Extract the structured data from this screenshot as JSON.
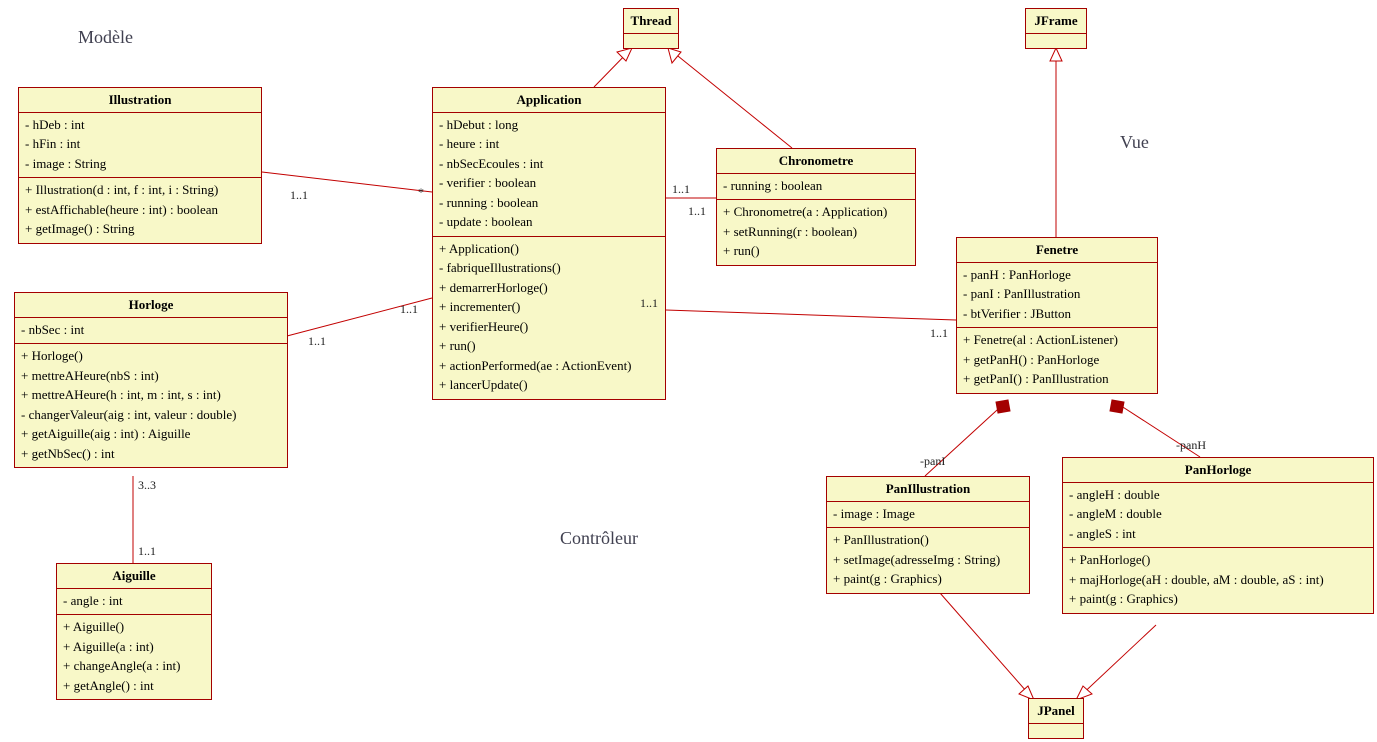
{
  "sections": {
    "modele": "Modèle",
    "vue": "Vue",
    "controleur": "Contrôleur"
  },
  "classes": {
    "thread": {
      "name": "Thread",
      "attrs": [],
      "ops": []
    },
    "jframe": {
      "name": "JFrame",
      "attrs": [],
      "ops": []
    },
    "jpanel": {
      "name": "JPanel",
      "attrs": [],
      "ops": []
    },
    "illustration": {
      "name": "Illustration",
      "attrs": [
        "- hDeb : int",
        "- hFin : int",
        "- image : String"
      ],
      "ops": [
        "+ Illustration(d : int, f : int, i : String)",
        "+ estAffichable(heure : int) : boolean",
        "+ getImage() : String"
      ]
    },
    "horloge": {
      "name": "Horloge",
      "attrs": [
        "- nbSec : int"
      ],
      "ops": [
        "+ Horloge()",
        "+ mettreAHeure(nbS : int)",
        "+ mettreAHeure(h : int, m : int, s : int)",
        "- changerValeur(aig : int, valeur : double)",
        "+ getAiguille(aig : int) : Aiguille",
        "+ getNbSec() : int"
      ]
    },
    "aiguille": {
      "name": "Aiguille",
      "attrs": [
        "- angle : int"
      ],
      "ops": [
        "+ Aiguille()",
        "+ Aiguille(a : int)",
        "+ changeAngle(a : int)",
        "+ getAngle() : int"
      ]
    },
    "application": {
      "name": "Application",
      "attrs": [
        "- hDebut : long",
        "- heure : int",
        "- nbSecEcoules : int",
        "- verifier : boolean",
        "- running : boolean",
        "- update : boolean"
      ],
      "ops": [
        "+ Application()",
        "- fabriqueIllustrations()",
        "+ demarrerHorloge()",
        "+ incrementer()",
        "+ verifierHeure()",
        "+ run()",
        "+ actionPerformed(ae : ActionEvent)",
        "+ lancerUpdate()"
      ]
    },
    "chronometre": {
      "name": "Chronometre",
      "attrs": [
        "- running : boolean"
      ],
      "ops": [
        "+ Chronometre(a : Application)",
        "+ setRunning(r : boolean)",
        "+ run()"
      ]
    },
    "fenetre": {
      "name": "Fenetre",
      "attrs": [
        "- panH : PanHorloge",
        "- panI : PanIllustration",
        "- btVerifier : JButton"
      ],
      "ops": [
        "+ Fenetre(al : ActionListener)",
        "+ getPanH() : PanHorloge",
        "+ getPanI() : PanIllustration"
      ]
    },
    "panillustration": {
      "name": "PanIllustration",
      "attrs": [
        "- image : Image"
      ],
      "ops": [
        "+ PanIllustration()",
        "+ setImage(adresseImg : String)",
        "+ paint(g : Graphics)"
      ]
    },
    "panhorloge": {
      "name": "PanHorloge",
      "attrs": [
        "- angleH : double",
        "- angleM : double",
        "- angleS : int"
      ],
      "ops": [
        "+ PanHorloge()",
        "+ majHorloge(aH : double, aM : double, aS : int)",
        "+ paint(g : Graphics)"
      ]
    }
  },
  "labels": {
    "m11": "1..1",
    "star": "*",
    "m33": "3..3",
    "panI": "-panI",
    "panH": "-panH"
  }
}
